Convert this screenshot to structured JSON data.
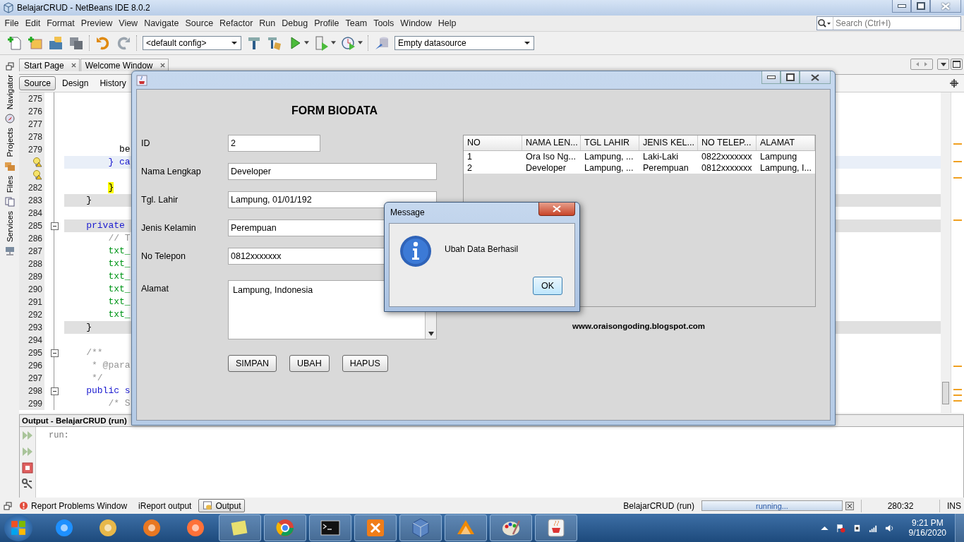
{
  "ide": {
    "title": "BelajarCRUD - NetBeans IDE 8.0.2",
    "menu": [
      "File",
      "Edit",
      "Format",
      "Preview",
      "View",
      "Navigate",
      "Source",
      "Refactor",
      "Run",
      "Debug",
      "Profile",
      "Team",
      "Tools",
      "Window",
      "Help"
    ],
    "search": {
      "placeholder": "Search (Ctrl+I)"
    },
    "config": "<default config>",
    "datasource": "Empty datasource",
    "side_tabs": [
      "Navigator",
      "Projects",
      "Files",
      "Services"
    ],
    "editor_tabs": [
      {
        "label": "Start Page",
        "selected": false
      },
      {
        "label": "Welcome Window",
        "selected": false
      }
    ],
    "view_tabs": [
      {
        "label": "Source",
        "selected": true
      },
      {
        "label": "Design",
        "selected": false
      },
      {
        "label": "History",
        "selected": false
      }
    ],
    "code_lines": [
      {
        "kind": "plain",
        "number": "275",
        "current": false,
        "highlighted": false,
        "collapsible": false
      },
      {
        "kind": "plain",
        "number": "276",
        "current": false,
        "highlighted": false,
        "collapsible": false
      },
      {
        "kind": "plain",
        "number": "277",
        "current": false,
        "highlighted": false,
        "collapsible": false
      },
      {
        "kind": "plain",
        "number": "278",
        "current": false,
        "highlighted": false,
        "collapsible": false
      },
      {
        "kind": "plain",
        "number": "279",
        "text": "          be",
        "current": false,
        "highlighted": false,
        "collapsible": false
      },
      {
        "kind": "hint",
        "text": "        } ca",
        "current": true,
        "highlighted": false,
        "collapsible": false
      },
      {
        "kind": "hint",
        "current": false,
        "highlighted": false,
        "collapsible": false
      },
      {
        "kind": "brace",
        "number": "282",
        "text": "        }",
        "current": false,
        "highlighted": false,
        "collapsible": false
      },
      {
        "kind": "plain",
        "number": "283",
        "text": "    }",
        "current": false,
        "highlighted": true,
        "collapsible": false
      },
      {
        "kind": "plain",
        "number": "284",
        "current": false,
        "highlighted": false,
        "collapsible": false
      },
      {
        "kind": "keyword",
        "number": "285",
        "text": "    private",
        "current": false,
        "highlighted": true,
        "collapsible": true
      },
      {
        "kind": "comment",
        "number": "286",
        "text": "        // T",
        "current": false,
        "highlighted": false,
        "collapsible": false
      },
      {
        "kind": "field",
        "number": "287",
        "text": "        txt_",
        "current": false,
        "highlighted": false,
        "collapsible": false
      },
      {
        "kind": "field",
        "number": "288",
        "text": "        txt_",
        "current": false,
        "highlighted": false,
        "collapsible": false
      },
      {
        "kind": "field",
        "number": "289",
        "text": "        txt_",
        "current": false,
        "highlighted": false,
        "collapsible": false
      },
      {
        "kind": "field",
        "number": "290",
        "text": "        txt_",
        "current": false,
        "highlighted": false,
        "collapsible": false
      },
      {
        "kind": "field",
        "number": "291",
        "text": "        txt_",
        "current": false,
        "highlighted": false,
        "collapsible": false
      },
      {
        "kind": "field",
        "number": "292",
        "text": "        txt_",
        "current": false,
        "highlighted": false,
        "collapsible": false
      },
      {
        "kind": "plain",
        "number": "293",
        "text": "    }",
        "current": false,
        "highlighted": true,
        "collapsible": false
      },
      {
        "kind": "plain",
        "number": "294",
        "current": false,
        "highlighted": false,
        "collapsible": false
      },
      {
        "kind": "comment",
        "number": "295",
        "text": "    /**",
        "current": false,
        "highlighted": false,
        "collapsible": true
      },
      {
        "kind": "comment",
        "number": "296",
        "text": "     * @para",
        "current": false,
        "highlighted": false,
        "collapsible": false
      },
      {
        "kind": "comment",
        "number": "297",
        "text": "     */",
        "current": false,
        "highlighted": false,
        "collapsible": false
      },
      {
        "kind": "keyword",
        "number": "298",
        "text": "    public s",
        "current": false,
        "highlighted": false,
        "collapsible": true
      },
      {
        "kind": "comment",
        "number": "299",
        "text": "        /* S",
        "current": false,
        "highlighted": false,
        "collapsible": false
      }
    ],
    "output": {
      "title": "Output - BelajarCRUD (run)",
      "text": "run:"
    },
    "bottom_tabs": [
      {
        "label": "Report Problems Window",
        "selected": false
      },
      {
        "label": "iReport output",
        "selected": false
      },
      {
        "label": "Output",
        "selected": true
      }
    ],
    "status": {
      "process": "BelajarCRUD (run)",
      "progress": {
        "text": "running...",
        "level": 1
      },
      "position": "280:32",
      "mode": "INS"
    }
  },
  "form": {
    "title": "FORM BIODATA",
    "fields": [
      {
        "label": "ID",
        "value": "2",
        "kind": "short"
      },
      {
        "label": "Nama Lengkap",
        "value": "Developer",
        "kind": "text"
      },
      {
        "label": "Tgl. Lahir",
        "value": "Lampung, 01/01/192",
        "kind": "text"
      },
      {
        "label": "Jenis Kelamin",
        "value": "Perempuan",
        "kind": "text"
      },
      {
        "label": "No Telepon",
        "value": "0812xxxxxxx",
        "kind": "text"
      },
      {
        "label": "Alamat",
        "value": "Lampung, Indonesia",
        "kind": "area"
      }
    ],
    "buttons": [
      "SIMPAN",
      "UBAH",
      "HAPUS"
    ],
    "table": {
      "columns": [
        "NO",
        "NAMA LEN...",
        "TGL LAHIR",
        "JENIS KEL...",
        "NO TELEP...",
        "ALAMAT"
      ],
      "rows": [
        [
          "1",
          "Ora Iso Ng...",
          "Lampung, ...",
          "Laki-Laki",
          "0822xxxxxxx",
          "Lampung"
        ],
        [
          "2",
          "Developer",
          "Lampung, ...",
          "Perempuan",
          "0812xxxxxxx",
          "Lampung, I..."
        ]
      ]
    },
    "link": "www.oraisongoding.blogspot.com"
  },
  "dialog": {
    "title": "Message",
    "message": "Ubah Data Berhasil",
    "button": "OK"
  },
  "taskbar": {
    "time": "9:21 PM",
    "date": "9/16/2020"
  }
}
